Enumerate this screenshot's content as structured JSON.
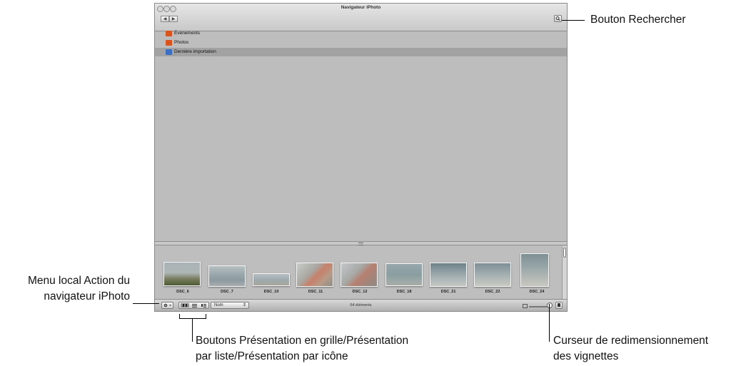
{
  "window": {
    "title": "Navigateur iPhoto",
    "nav_back": "◀",
    "nav_forward": "▶",
    "sources": [
      {
        "label": "Événements",
        "icon": "events-icon",
        "color": "#d9531e"
      },
      {
        "label": "Photos",
        "icon": "photos-icon",
        "color": "#d9531e"
      },
      {
        "label": "Dernière importation",
        "icon": "import-icon",
        "color": "#3a6fc4"
      }
    ],
    "thumbnails": [
      {
        "caption": "DSC_6"
      },
      {
        "caption": "DSC_7"
      },
      {
        "caption": "DSC_10"
      },
      {
        "caption": "DSC_11"
      },
      {
        "caption": "DSC_12"
      },
      {
        "caption": "DSC_18"
      },
      {
        "caption": "DSC_21"
      },
      {
        "caption": "DSC_22"
      },
      {
        "caption": "DSC_24"
      }
    ],
    "sort_label": "Nom",
    "item_count": "64 éléments"
  },
  "callouts": {
    "search": "Bouton Rechercher",
    "action_menu_line1": "Menu local Action du",
    "action_menu_line2": "navigateur iPhoto",
    "view_buttons_line1": "Boutons Présentation en grille/Présentation",
    "view_buttons_line2": "par liste/Présentation par icône",
    "slider_line1": "Curseur de redimensionnement",
    "slider_line2": "des vignettes"
  }
}
